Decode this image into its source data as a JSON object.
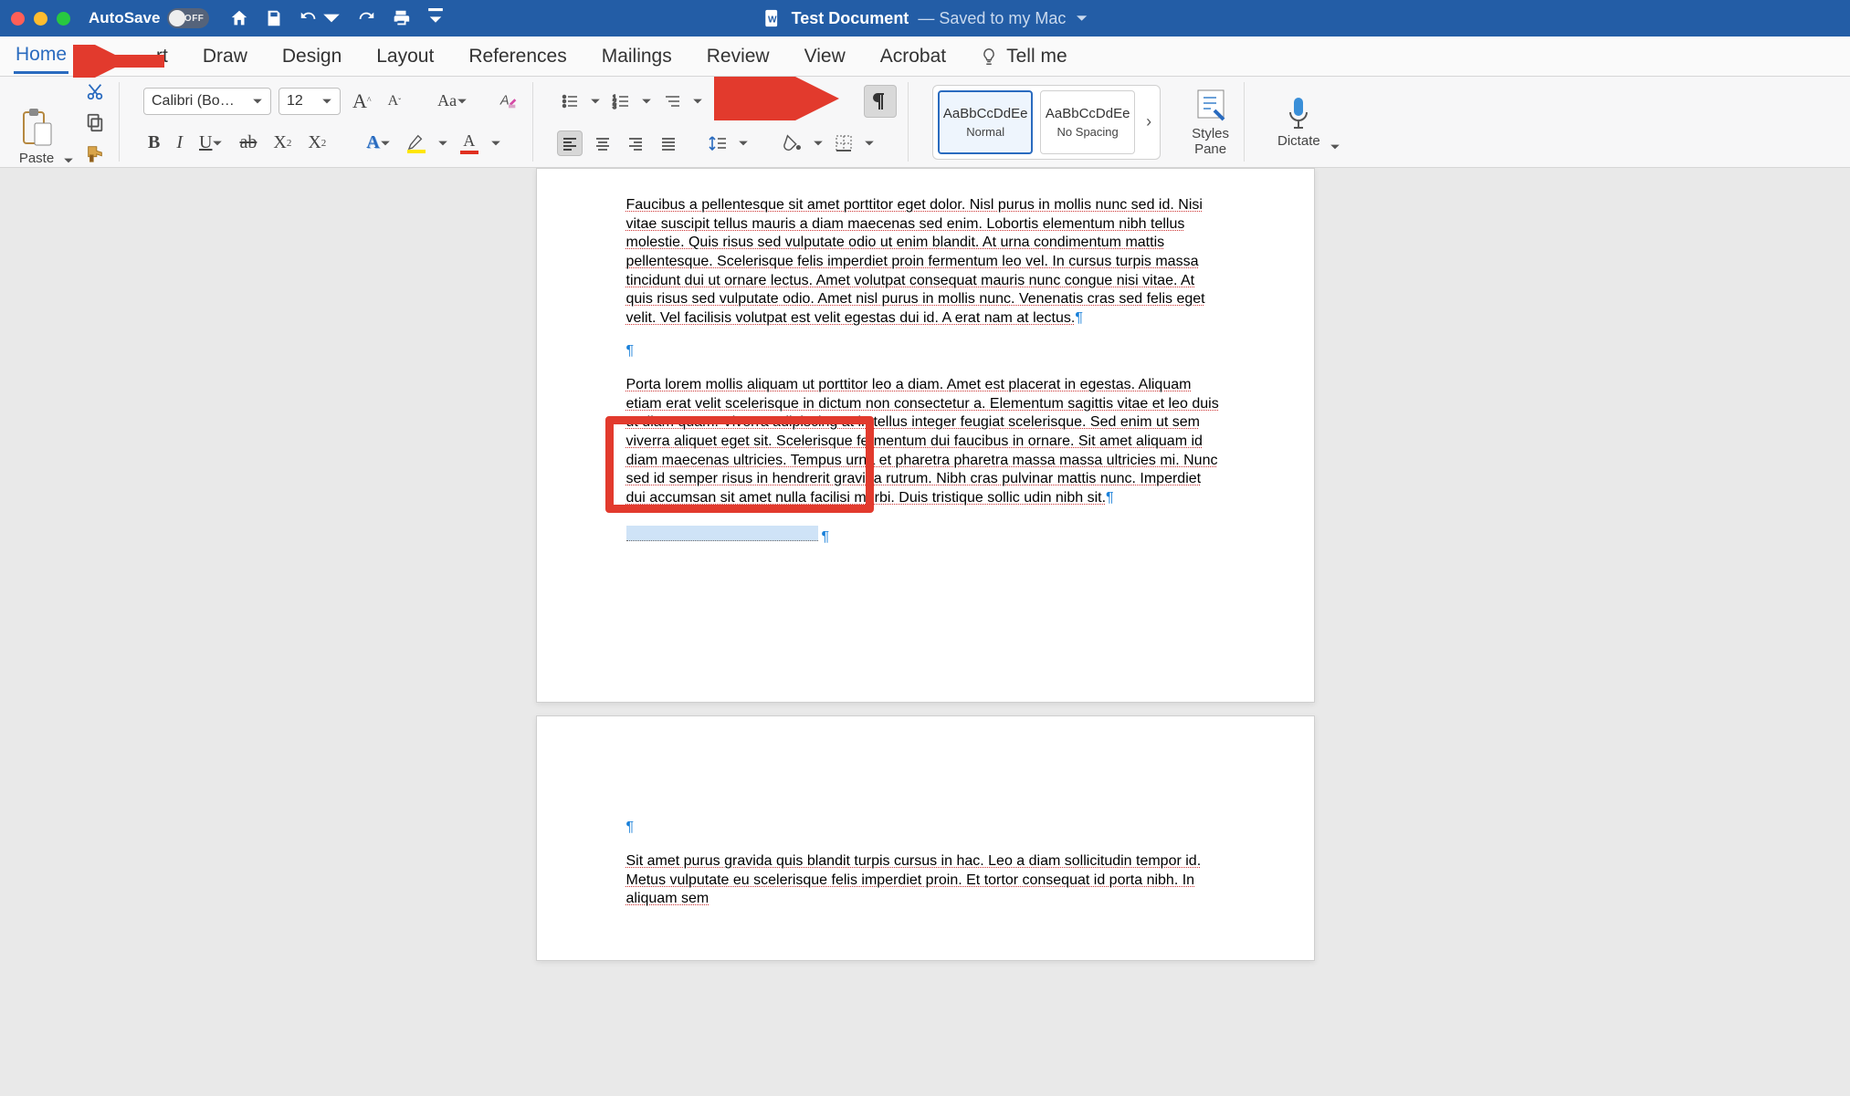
{
  "titlebar": {
    "traffic_colors": [
      "#ff5f57",
      "#febc2e",
      "#28c840"
    ],
    "autosave_label": "AutoSave",
    "autosave_state": "OFF",
    "doc_name": "Test Document",
    "saved_label": "— Saved to my Mac"
  },
  "tabs": {
    "home": "Home",
    "insert": "rt",
    "draw": "Draw",
    "design": "Design",
    "layout": "Layout",
    "references": "References",
    "mailings": "Mailings",
    "review": "Review",
    "view": "View",
    "acrobat": "Acrobat",
    "tellme": "Tell me"
  },
  "ribbon": {
    "paste": "Paste",
    "font_name": "Calibri (Bo…",
    "font_size": "12",
    "style_sample": "AaBbCcDdEe",
    "style_normal": "Normal",
    "style_nospacing": "No Spacing",
    "styles_pane": "Styles\nPane",
    "dictate": "Dictate"
  },
  "doc": {
    "p1": "Faucibus a pellentesque sit amet porttitor eget dolor. Nisl purus in mollis nunc sed id. Nisi vitae suscipit tellus mauris a diam maecenas sed enim. Lobortis elementum nibh tellus molestie. Quis risus sed vulputate odio ut enim blandit. At urna condimentum mattis pellentesque. Scelerisque felis imperdiet proin fermentum leo vel. In cursus turpis massa tincidunt dui ut ornare lectus. Amet volutpat consequat mauris nunc congue nisi vitae. At quis risus sed vulputate odio. Amet nisl purus in mollis nunc. Venenatis cras sed felis eget velit. Vel facilisis volutpat est velit egestas dui id. A erat nam at lectus.",
    "p2": "Porta lorem mollis aliquam ut porttitor leo a diam. Amet est placerat in egestas. Aliquam etiam erat velit scelerisque in dictum non consectetur a. Elementum sagittis vitae et leo duis ut diam quam. Viverra adipiscing at in tellus integer feugiat scelerisque. Sed enim ut sem viverra aliquet eget sit. Scelerisque fermentum dui faucibus in ornare. Sit amet aliquam id diam maecenas ultricies. Tempus urna et pharetra pharetra massa massa ultricies mi. Nunc sed id semper risus in hendrerit gravida rutrum. Nibh cras pulvinar mattis nunc. Imperdiet dui accumsan sit amet nulla facilisi morbi. Duis tristique sollic  udin nibh sit.",
    "p3": "Sit amet purus gravida quis blandit turpis cursus in hac. Leo a diam sollicitudin tempor id. Metus vulputate eu scelerisque felis imperdiet proin. Et tortor consequat id porta nibh. In aliquam sem",
    "pil": "¶"
  }
}
